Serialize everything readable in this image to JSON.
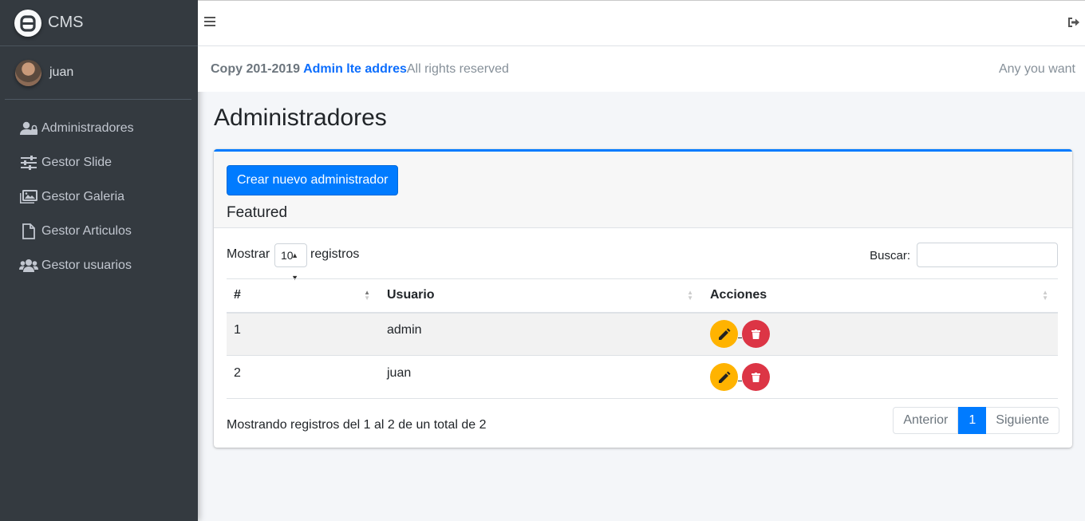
{
  "brand": {
    "name": "CMS"
  },
  "user": {
    "name": "juan"
  },
  "sidebar": {
    "items": [
      {
        "label": "Administradores",
        "icon": "user-lock-icon"
      },
      {
        "label": "Gestor Slide",
        "icon": "sliders-icon"
      },
      {
        "label": "Gestor Galeria",
        "icon": "images-icon"
      },
      {
        "label": "Gestor Articulos",
        "icon": "file-icon"
      },
      {
        "label": "Gestor usuarios",
        "icon": "users-icon"
      }
    ]
  },
  "infobar": {
    "copy": "Copy 201-2019",
    "brand_link": "Admin lte addres",
    "rights": "All rights reserved",
    "right_text": "Any you want"
  },
  "page": {
    "title": "Administradores"
  },
  "card": {
    "create_button": "Crear nuevo administrador",
    "title": "Featured"
  },
  "table_controls": {
    "show_label": "Mostrar",
    "page_length": "10",
    "records_label": "registros",
    "search_label": "Buscar:",
    "search_value": ""
  },
  "table": {
    "columns": [
      "#",
      "Usuario",
      "Acciones"
    ],
    "rows": [
      {
        "id": "1",
        "user": "admin"
      },
      {
        "id": "2",
        "user": "juan"
      }
    ]
  },
  "footer": {
    "info": "Mostrando registros del 1 al 2 de un total de 2",
    "prev": "Anterior",
    "page": "1",
    "next": "Siguiente"
  },
  "colors": {
    "sidebar_bg": "#343a40",
    "primary": "#007bff",
    "edit": "#ffb300",
    "delete": "#dc3545"
  }
}
